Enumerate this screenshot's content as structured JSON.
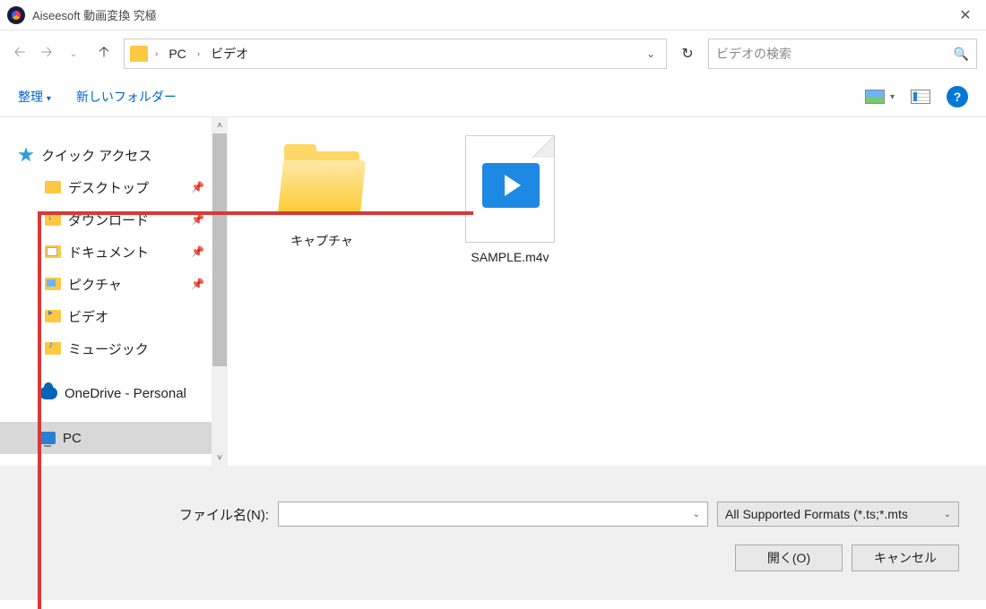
{
  "window": {
    "title": "Aiseesoft 動画変換 究極"
  },
  "nav": {
    "breadcrumb": {
      "root": "PC",
      "folder": "ビデオ"
    },
    "search_placeholder": "ビデオの検索"
  },
  "toolbar": {
    "organize": "整理",
    "new_folder": "新しいフォルダー"
  },
  "sidebar": {
    "quick_access": "クイック アクセス",
    "items": [
      {
        "label": "デスクトップ",
        "pinned": true
      },
      {
        "label": "ダウンロード",
        "pinned": true
      },
      {
        "label": "ドキュメント",
        "pinned": true
      },
      {
        "label": "ピクチャ",
        "pinned": true
      },
      {
        "label": "ビデオ",
        "pinned": false
      },
      {
        "label": "ミュージック",
        "pinned": false
      }
    ],
    "onedrive": "OneDrive - Personal",
    "pc": "PC"
  },
  "files": {
    "folder": "キャプチャ",
    "video": "SAMPLE.m4v"
  },
  "footer": {
    "filename_label": "ファイル名(N):",
    "filter": "All Supported Formats (*.ts;*.mts",
    "open": "開く(O)",
    "cancel": "キャンセル"
  }
}
